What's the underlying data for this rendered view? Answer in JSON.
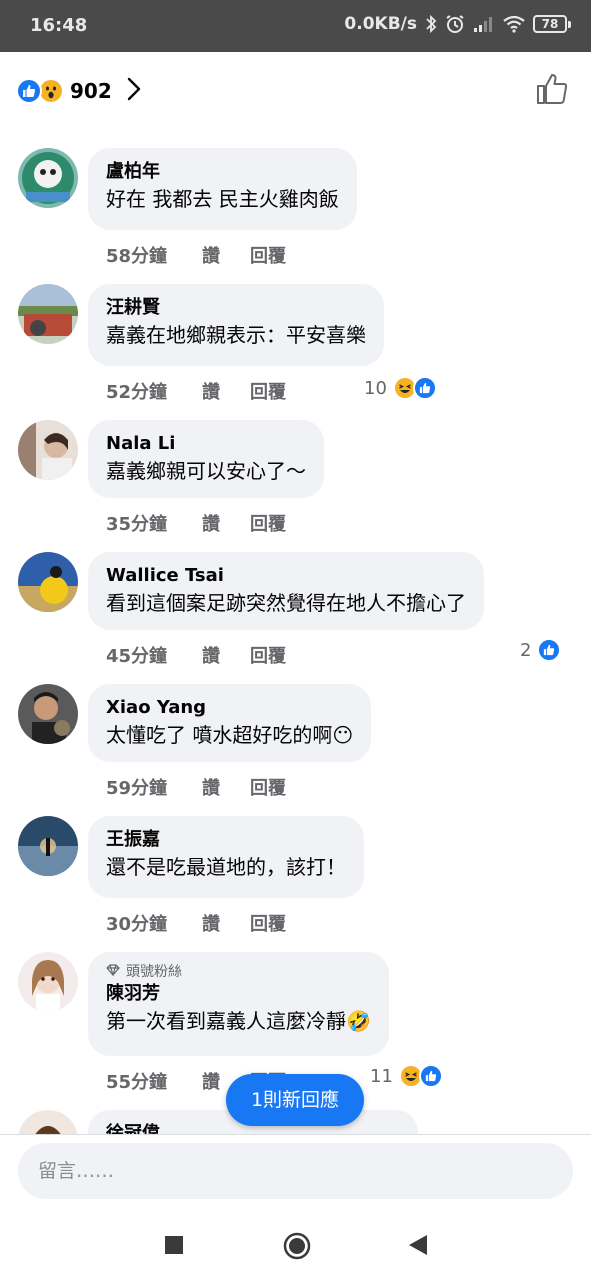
{
  "status_bar": {
    "time": "16:48",
    "network_speed": "0.0KB/s",
    "battery": "78"
  },
  "header": {
    "reaction_count": "902",
    "reaction_icons": [
      "like-icon",
      "wow-icon"
    ]
  },
  "comments": [
    {
      "author": "盧柏年",
      "text": "好在 我都去 民主火雞肉飯",
      "time": "58分鐘",
      "like_label": "讚",
      "reply_label": "回覆",
      "avatar_color": "#8fb8a8"
    },
    {
      "author": "汪耕賢",
      "text": "嘉義在地鄉親表示：平安喜樂",
      "time": "52分鐘",
      "like_label": "讚",
      "reply_label": "回覆",
      "reaction_count": "10",
      "reactions": [
        "haha-icon",
        "like-icon"
      ],
      "avatar_color": "#7a8a6a"
    },
    {
      "author": "Nala Li",
      "text": "嘉義鄉親可以安心了～",
      "time": "35分鐘",
      "like_label": "讚",
      "reply_label": "回覆",
      "avatar_color": "#c9b8a8"
    },
    {
      "author": "Wallice Tsai",
      "text": "看到這個案足跡突然覺得在地人不擔心了",
      "time": "45分鐘",
      "like_label": "讚",
      "reply_label": "回覆",
      "reaction_count": "2",
      "reactions": [
        "like-icon"
      ],
      "avatar_color": "#2f5fa8"
    },
    {
      "author": "Xiao Yang",
      "text": "太懂吃了 噴水超好吃的啊😶",
      "time": "59分鐘",
      "like_label": "讚",
      "reply_label": "回覆",
      "avatar_color": "#3a3a3a"
    },
    {
      "author": "王振嘉",
      "text": "還不是吃最道地的，該打！",
      "time": "30分鐘",
      "like_label": "讚",
      "reply_label": "回覆",
      "avatar_color": "#4a6a8a"
    },
    {
      "author": "陳羽芳",
      "badge": "頭號粉絲",
      "text": "第一次看到嘉義人這麼冷靜🤣",
      "time": "55分鐘",
      "like_label": "讚",
      "reply_label": "回覆",
      "reaction_count": "11",
      "reactions": [
        "haha-icon",
        "like-icon"
      ],
      "avatar_color": "#e8d8c8"
    },
    {
      "author": "徐冠偉",
      "avatar_color": "#d8b898"
    }
  ],
  "new_reply_button": "1則新回應",
  "comment_input": {
    "placeholder": "留言……"
  },
  "nav": [
    "recents-button",
    "home-button",
    "back-button"
  ]
}
